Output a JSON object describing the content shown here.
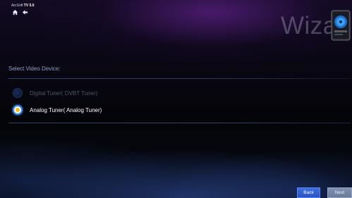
{
  "app": {
    "brand": "ArcSoft",
    "product": "TV 5.0"
  },
  "header": {
    "wizard_title": "Wiza",
    "home_icon": "home-icon",
    "back_icon": "back-arrow-icon",
    "logo_icon": "disc-logo-icon"
  },
  "section": {
    "label": "Select Video Device:"
  },
  "options": [
    {
      "label": "Digital Tuner( DVBT Tuner)",
      "selected": false,
      "enabled": false
    },
    {
      "label": "Analog Tuner( Analog Tuner)",
      "selected": true,
      "enabled": true
    }
  ],
  "footer": {
    "back_label": "Back",
    "next_label": "Next"
  },
  "colors": {
    "accent": "#3a8af0",
    "selected_dot": "#f2c418",
    "back_button": "#3f6fe0",
    "next_button": "#8090b0"
  }
}
